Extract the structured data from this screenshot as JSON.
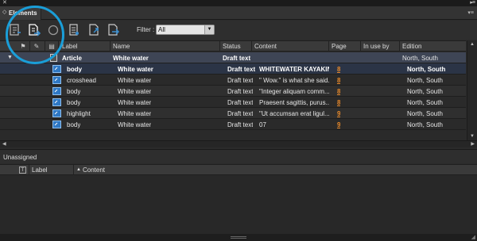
{
  "window": {
    "close_glyph": "✕",
    "menu_glyph": "▸≡"
  },
  "panel": {
    "tab_label": "Elements",
    "tab_arrows": "◇",
    "panel_menu_glyph": "▾≡"
  },
  "toolbar": {
    "tools": [
      {
        "name": "add-element-icon"
      },
      {
        "name": "export-element-icon"
      },
      {
        "name": "circle-icon"
      },
      {
        "name": "document-list-icon"
      },
      {
        "name": "link-element-icon"
      },
      {
        "name": "place-element-icon"
      }
    ],
    "filter_label": "Filter :",
    "filter_value": "All",
    "accent": "#1a9ed8"
  },
  "table": {
    "columns": [
      "Label",
      "Name",
      "Status",
      "Content",
      "Page",
      "In use by",
      "Edition"
    ],
    "article": {
      "label": "Article",
      "name": "White water",
      "status": "Draft text",
      "edition": "North, South"
    },
    "rows": [
      {
        "label": "body",
        "name": "White water",
        "status": "Draft text",
        "content": "WHITEWATER KAYAKING",
        "page": "8",
        "edition": "North, South",
        "selected": true
      },
      {
        "label": "crosshead",
        "name": "White water",
        "status": "Draft text",
        "content": "\" Wow.\" is what she said...",
        "page": "8",
        "edition": "North, South"
      },
      {
        "label": "body",
        "name": "White water",
        "status": "Draft text",
        "content": "\"Integer aliquam comm...",
        "page": "8",
        "edition": "North, South"
      },
      {
        "label": "body",
        "name": "White water",
        "status": "Draft text",
        "content": "Praesent sagittis, purus...",
        "page": "8",
        "edition": "North, South"
      },
      {
        "label": "highlight",
        "name": "White water",
        "status": "Draft text",
        "content": "\"Ut accumsan erat ligul...",
        "page": "9",
        "edition": "North, South"
      },
      {
        "label": "body",
        "name": "White water",
        "status": "Draft text",
        "content": "07",
        "page": "9",
        "edition": "North, South"
      }
    ]
  },
  "unassigned": {
    "title": "Unassigned",
    "columns": [
      "Label",
      "Content"
    ],
    "type_icon": "T"
  },
  "colors": {
    "page_link": "#e8892a",
    "selection": "#3e4555"
  }
}
